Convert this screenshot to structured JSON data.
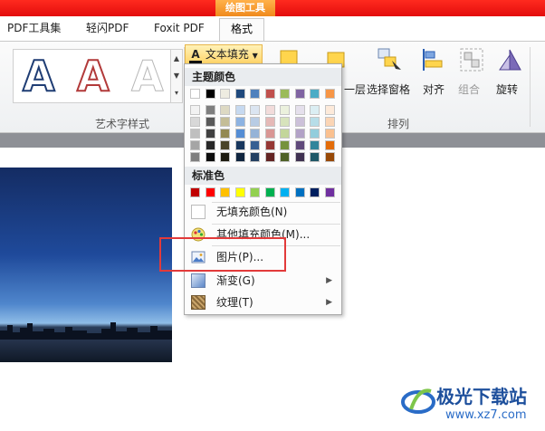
{
  "tabs": {
    "context_label": "绘图工具",
    "items": [
      {
        "label": "PDF工具集"
      },
      {
        "label": "轻闪PDF"
      },
      {
        "label": "Foxit PDF"
      },
      {
        "label": "格式"
      }
    ]
  },
  "ribbon": {
    "wordart_letter": "A",
    "wordart_group_label": "艺术字样式",
    "text_fill_label": "文本填充",
    "arrange_group_label": "排列",
    "buttons": {
      "bring_forward_partial": "一层",
      "selection_pane": "选择窗格",
      "align": "对齐",
      "group": "组合",
      "rotate": "旋转"
    }
  },
  "menu": {
    "theme_colors_header": "主题颜色",
    "standard_colors_header": "标准色",
    "theme_top_row": [
      "#ffffff",
      "#000000",
      "#eeece1",
      "#1f497d",
      "#4f81bd",
      "#c0504d",
      "#9bbb59",
      "#8064a2",
      "#4bacc6",
      "#f79646"
    ],
    "theme_shades": [
      [
        "#f2f2f2",
        "#7f7f7f",
        "#ddd9c3",
        "#c6d9f0",
        "#dbe5f1",
        "#f2dcdb",
        "#ebf1dd",
        "#e5e0ec",
        "#dbeef3",
        "#fdeada"
      ],
      [
        "#d8d8d8",
        "#595959",
        "#c4bd97",
        "#8db3e2",
        "#b8cce4",
        "#e5b9b7",
        "#d7e3bc",
        "#ccc1d9",
        "#b7dde8",
        "#fbd5b5"
      ],
      [
        "#bfbfbf",
        "#3f3f3f",
        "#938953",
        "#548dd4",
        "#95b3d7",
        "#d99694",
        "#c3d69b",
        "#b2a2c7",
        "#92cddc",
        "#fac08f"
      ],
      [
        "#a5a5a5",
        "#262626",
        "#494429",
        "#17365d",
        "#366092",
        "#953734",
        "#76923c",
        "#5f497a",
        "#31859b",
        "#e36c09"
      ],
      [
        "#7f7f7f",
        "#0c0c0c",
        "#1d1b10",
        "#0f243e",
        "#244061",
        "#632423",
        "#4f6128",
        "#3f3151",
        "#205867",
        "#974806"
      ]
    ],
    "standard_colors": [
      "#c00000",
      "#ff0000",
      "#ffc000",
      "#ffff00",
      "#92d050",
      "#00b050",
      "#00b0f0",
      "#0070c0",
      "#002060",
      "#7030a0"
    ],
    "items": {
      "no_fill": "无填充颜色(N)",
      "more_colors": "其他填充颜色(M)...",
      "picture": "图片(P)...",
      "gradient": "渐变(G)",
      "texture": "纹理(T)"
    }
  },
  "watermark": {
    "title": "极光下载站",
    "url": "www.xz7.com"
  }
}
